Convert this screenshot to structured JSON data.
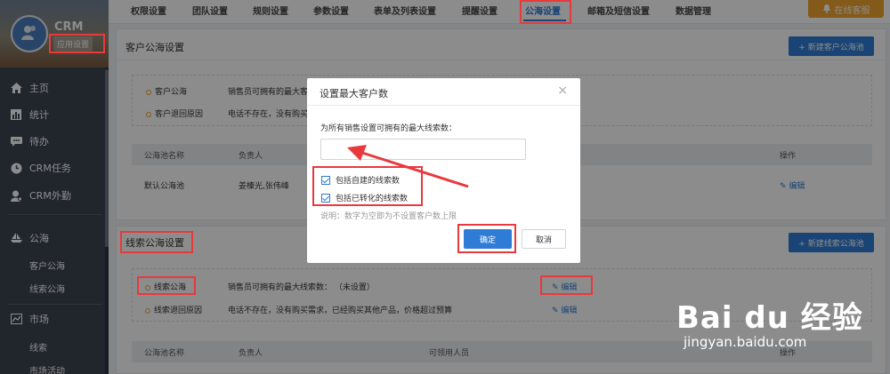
{
  "sidebar": {
    "brand": "CRM",
    "brand_sub": "应用设置",
    "items": [
      {
        "label": "主页",
        "icon": "home-icon"
      },
      {
        "label": "统计",
        "icon": "bar-chart-icon"
      },
      {
        "label": "待办",
        "icon": "chat-icon"
      },
      {
        "label": "CRM任务",
        "icon": "clock-icon"
      },
      {
        "label": "CRM外勤",
        "icon": "user-pin-icon"
      },
      {
        "label": "公海",
        "icon": "boat-icon"
      },
      {
        "label": "市场",
        "icon": "trend-icon"
      }
    ],
    "subitems_gonghai": [
      "客户公海",
      "线索公海"
    ],
    "subitems_market": [
      "线索",
      "市场活动"
    ]
  },
  "topbar": {
    "tabs": [
      "权限设置",
      "团队设置",
      "规则设置",
      "参数设置",
      "表单及列表设置",
      "提醒设置",
      "公海设置",
      "邮箱及短信设置",
      "数据管理"
    ],
    "active_tab": "公海设置",
    "service_button": "在线客服"
  },
  "customer_pool": {
    "title": "客户公海设置",
    "new_button": "+ 新建客户公海池",
    "rows": [
      {
        "name": "客户公海",
        "desc": "销售员可拥有的最大客"
      },
      {
        "name": "客户退回原因",
        "desc": "电话不存在，没有购买"
      }
    ],
    "table_headers": [
      "公海池名称",
      "负责人",
      "操作"
    ],
    "table_rows": [
      {
        "name": "默认公海池",
        "owner": "姜榛光,张伟峰",
        "action": "编辑"
      }
    ]
  },
  "lead_pool": {
    "title": "线索公海设置",
    "new_button": "+ 新建线索公海池",
    "rows": [
      {
        "name": "线索公海",
        "desc": "销售员可拥有的最大线索数：  （未设置）",
        "action": "编辑"
      },
      {
        "name": "线索退回原因",
        "desc": "电话不存在，没有购买需求，已经购买其他产品，价格超过预算",
        "action": "编辑"
      }
    ],
    "table_headers": [
      "公海池名称",
      "负责人",
      "可领用人员",
      "操作"
    ]
  },
  "modal": {
    "title": "设置最大客户数",
    "label": "为所有销售设置可拥有的最大线索数：",
    "input_value": "",
    "checkbox_1": "包括自建的线索数",
    "checkbox_2": "包括已转化的线索数",
    "note": "说明：数字为空即为不设置客户数上限",
    "ok": "确定",
    "cancel": "取消",
    "close": "×"
  },
  "watermark": {
    "logo": "Bai du 经验",
    "url": "jingyan.baidu.com"
  },
  "colors": {
    "primary": "#2e7cd6",
    "accent_orange": "#f0a531",
    "highlight_red": "#e8393d",
    "sidebar_bg": "#3c4450"
  }
}
